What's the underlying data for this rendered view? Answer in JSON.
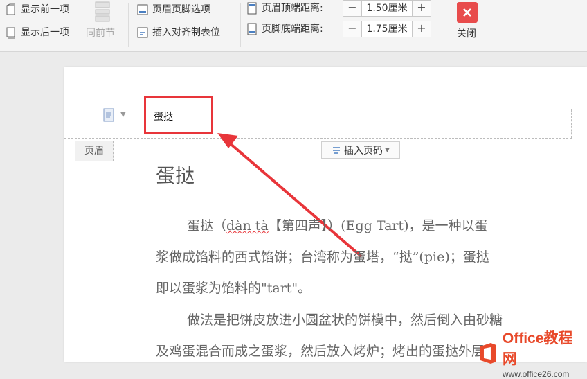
{
  "toolbar": {
    "show_prev": "显示前一项",
    "show_next": "显示后一项",
    "same_as_prev": "同前节",
    "header_footer_options": "页眉页脚选项",
    "insert_align_tab": "插入对齐制表位",
    "header_top_label": "页眉顶端距离:",
    "header_top_value": "1.50厘米",
    "footer_bottom_label": "页脚底端距离:",
    "footer_bottom_value": "1.75厘米",
    "minus": "−",
    "plus": "+",
    "close_label": "关闭"
  },
  "page": {
    "header_text": "蛋挞",
    "header_tag": "页眉",
    "insert_page_number": "插入页码",
    "doc_title": "蛋挞",
    "p1_line1_a": "蛋挞（",
    "p1_line1_pinyin": "dàn tà",
    "p1_line1_b": "【第四声】）(Egg Tart)，是一种以蛋",
    "p1_line2": "浆做成馅料的西式馅饼；台湾称为蛋塔，“挞”(pie)；蛋挞",
    "p1_line3": "即以蛋浆为馅料的\"tart\"。",
    "p2_line1": "做法是把饼皮放进小圆盆状的饼模中，然后倒入由砂糖",
    "p2_line2": "及鸡蛋混合而成之蛋浆，然后放入烤炉；烤出的蛋挞外层"
  },
  "watermark": {
    "brand": "Office教程网",
    "url": "www.office26.com"
  },
  "colors": {
    "accent_red": "#e8353a",
    "close_red": "#e84c4c"
  }
}
